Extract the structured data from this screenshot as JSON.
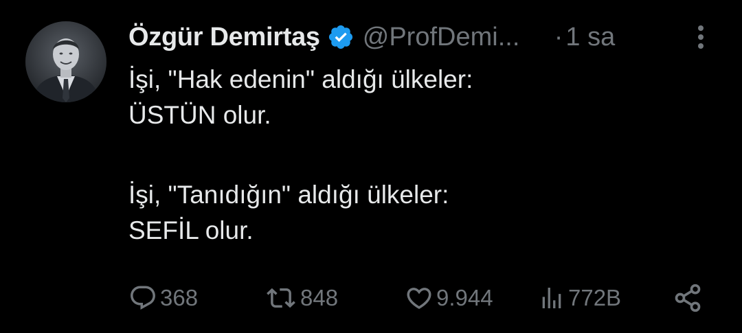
{
  "tweet": {
    "author": {
      "display_name": "Özgür Demirtaş",
      "handle": "@ProfDemi...",
      "verified": true,
      "verified_color": "#1d9bf0",
      "avatar_icon": "profile-photo"
    },
    "separator": "·",
    "time": "1 sa",
    "more_icon": "vertical-ellipsis-icon",
    "text_lines": [
      "İşi, \"Hak edenin\" aldığı ülkeler:",
      "ÜSTÜN olur.",
      "",
      "İşi, \"Tanıdığın\" aldığı ülkeler:",
      "SEFİL olur."
    ],
    "actions": {
      "reply": {
        "icon": "reply-bubble-icon",
        "count": "368"
      },
      "retweet": {
        "icon": "retweet-icon",
        "count": "848"
      },
      "like": {
        "icon": "heart-icon",
        "count": "9.944"
      },
      "views": {
        "icon": "views-bar-chart-icon",
        "count": "772B"
      },
      "share": {
        "icon": "share-icon"
      }
    }
  },
  "colors": {
    "background": "#000000",
    "primary_text": "#e7e9ea",
    "secondary_text": "#71767b"
  }
}
